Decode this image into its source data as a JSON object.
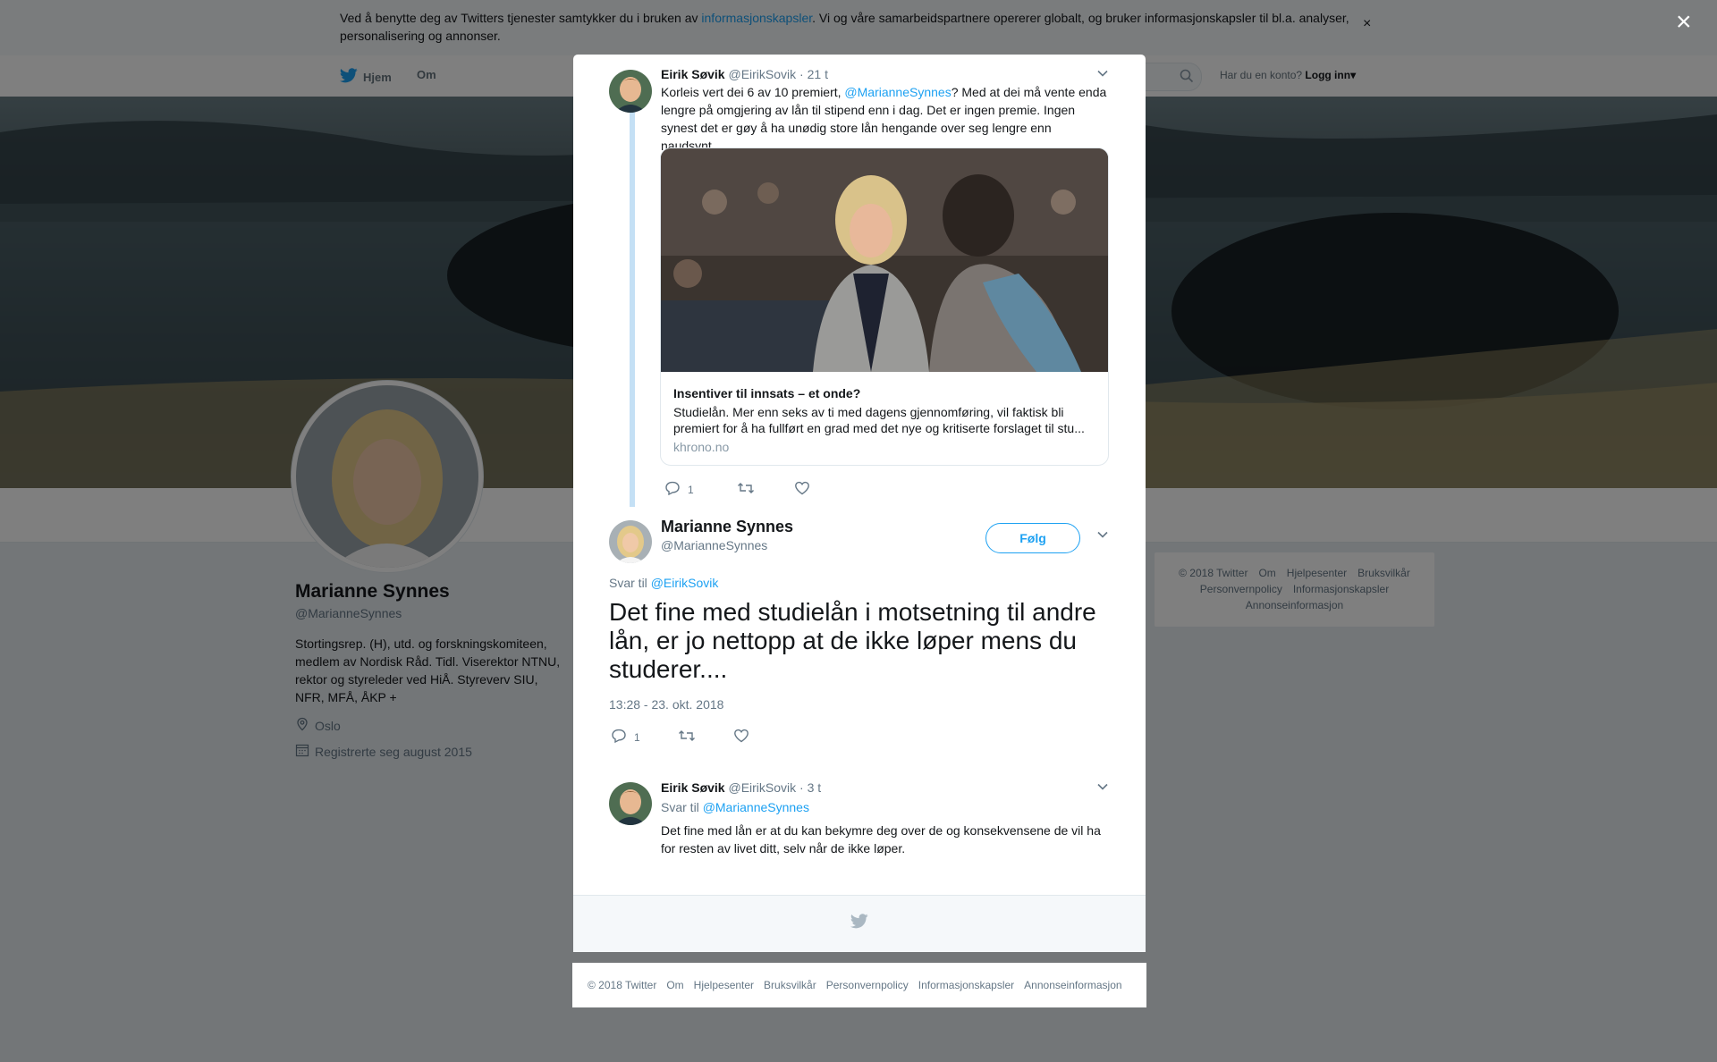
{
  "cookie_banner": {
    "text_before": "Ved å benytte deg av Twitters tjenester samtykker du i bruken av ",
    "link": "informasjonskapsler",
    "text_after": ". Vi og våre samarbeidspartnere opererer globalt, og bruker informasjonskapsler til bl.a. analyser, personalisering og annonser.",
    "close": "×"
  },
  "nav": {
    "home": "Hjem",
    "about": "Om",
    "account_prompt": "Har du en konto?",
    "login": "Logg inn",
    "login_caret": "▾"
  },
  "profile": {
    "name": "Marianne Synnes",
    "handle": "@MarianneSynnes",
    "bio": "Stortingsrep. (H), utd. og forskningskomiteen, medlem av Nordisk Råd. Tidl. Viserektor NTNU, rektor og styreleder ved HiÅ. Styreverv SIU, NFR, MFÅ, ÅKP +",
    "location": "Oslo",
    "joined": "Registrerte seg august 2015"
  },
  "side_footer": [
    "© 2018 Twitter",
    "Om",
    "Hjelpesenter",
    "Bruksvilkår",
    "Personvernpolicy",
    "Informasjonskapsler",
    "Annonseinformasjon"
  ],
  "overlay_close": "×",
  "tweet1": {
    "name": "Eirik Søvik",
    "handle": "@EirikSovik",
    "sep": "·",
    "time": "21 t",
    "text_before": "Korleis vert dei 6 av 10 premiert, ",
    "mention": "@MarianneSynnes",
    "text_after": "? Med at dei må vente enda lengre på omgjering av lån til stipend enn i dag. Det er ingen premie. Ingen synest det er gøy å ha unødig store lån hengande over seg lengre enn naudsynt.",
    "card": {
      "title": "Insentiver til innsats – et onde?",
      "description": "Studielån. Mer enn seks av ti med dagens gjennomføring, vil faktisk bli premiert for å ha fullført en grad med det nye og kritiserte forslaget til stu...",
      "domain": "khrono.no"
    },
    "reply_count": "1"
  },
  "main_tweet": {
    "name": "Marianne Synnes",
    "handle": "@MarianneSynnes",
    "follow": "Følg",
    "reply_prefix": "Svar til ",
    "reply_to": "@EirikSovik",
    "text": "Det fine med studielån i motsetning til andre lån, er jo nettopp at de ikke løper mens du studerer....",
    "timestamp": "13:28 - 23. okt. 2018",
    "reply_count": "1"
  },
  "tweet2": {
    "name": "Eirik Søvik",
    "handle": "@EirikSovik",
    "sep": "·",
    "time": "3 t",
    "reply_prefix": "Svar til ",
    "reply_to": "@MarianneSynnes",
    "text": "Det fine med lån er at du kan bekymre deg over de og konsekvensene de vil ha for resten av livet ditt, selv når de ikke løper."
  },
  "modal_footer": [
    "© 2018 Twitter",
    "Om",
    "Hjelpesenter",
    "Bruksvilkår",
    "Personvernpolicy",
    "Informasjonskapsler",
    "Annonseinformasjon"
  ],
  "colors": {
    "twitter_blue": "#1da1f2",
    "thread_line": "#c4e0f5",
    "secondary_text": "#657786"
  }
}
